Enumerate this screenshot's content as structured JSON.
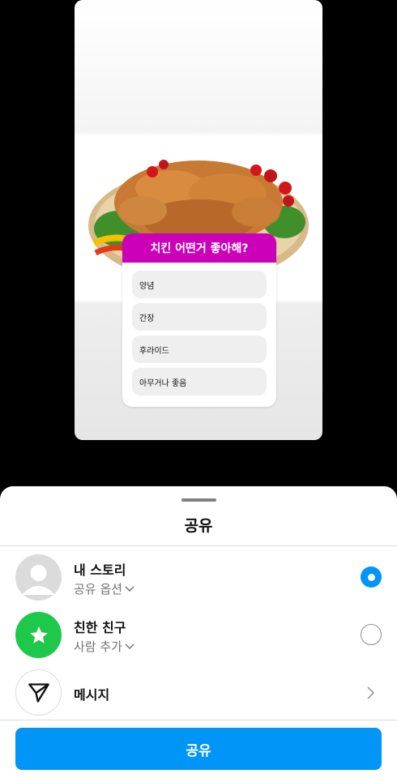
{
  "story": {
    "poll": {
      "question": "치킨 어떤거 좋아해?",
      "options": [
        "양념",
        "간장",
        "후라이드",
        "아무거나 좋음"
      ]
    }
  },
  "sheet": {
    "title": "공유",
    "rows": [
      {
        "title": "내 스토리",
        "subtitle": "공유 옵션",
        "icon": "avatar-placeholder-icon",
        "control": "radio-selected"
      },
      {
        "title": "친한 친구",
        "subtitle": "사람 추가",
        "icon": "star-icon",
        "control": "radio-unselected"
      },
      {
        "title": "메시지",
        "icon": "paper-plane-icon",
        "control": "chevron-right-icon"
      }
    ],
    "share_button": "공유"
  },
  "colors": {
    "accent": "#0095f6",
    "poll_header": "#cc00b8",
    "close_friends": "#1ec84a"
  }
}
